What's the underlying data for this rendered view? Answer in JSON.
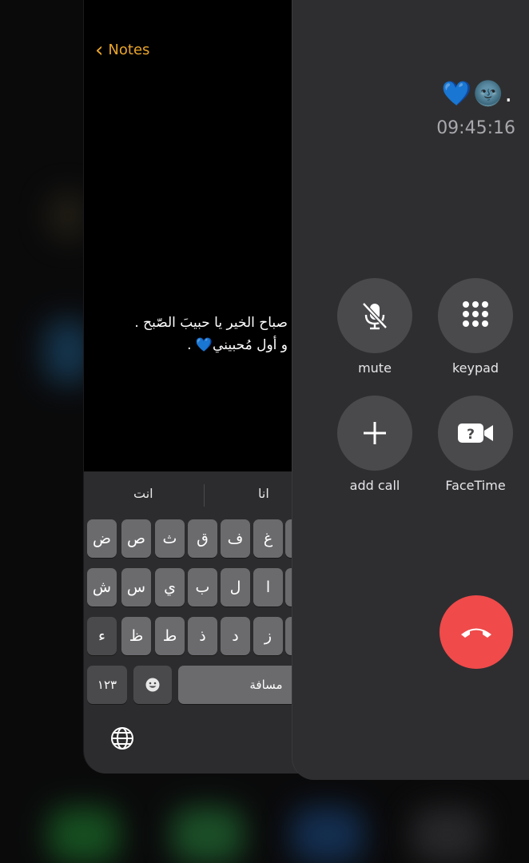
{
  "notes": {
    "back_label": "Notes",
    "note_line1": "صباح الخير يا حبيبَ الصّبح .",
    "note_line2": "و أول مُحبيني💙 ."
  },
  "keyboard": {
    "suggestions": [
      "انت",
      "انا"
    ],
    "row1": [
      "ض",
      "ص",
      "ث",
      "ق",
      "ف",
      "غ"
    ],
    "row2": [
      "ش",
      "س",
      "ي",
      "ب",
      "ل",
      "ا"
    ],
    "row3": [
      "ء",
      "ظ",
      "ط",
      "ذ",
      "د",
      "ز"
    ],
    "numbers_key": "١٢٣",
    "space_key": "مسافة"
  },
  "call": {
    "caller_name": "💙🌚.",
    "timer": "09:45:16",
    "controls": {
      "mute": "mute",
      "keypad": "keypad",
      "add_call": "add call",
      "facetime": "FaceTime"
    }
  }
}
